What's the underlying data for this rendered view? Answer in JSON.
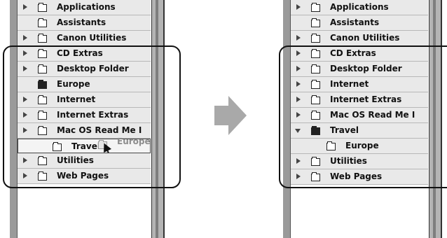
{
  "before": {
    "rows": [
      {
        "label": "Applications",
        "disclosure": "closed",
        "icon": "folder-icon"
      },
      {
        "label": "Assistants",
        "disclosure": "none",
        "icon": "folder-icon"
      },
      {
        "label": "Canon Utilities",
        "disclosure": "closed",
        "icon": "folder-icon"
      },
      {
        "label": "CD Extras",
        "disclosure": "closed",
        "icon": "folder-icon"
      },
      {
        "label": "Desktop Folder",
        "disclosure": "closed",
        "icon": "folder-icon"
      },
      {
        "label": "Europe",
        "disclosure": "none",
        "icon": "folder-dark-icon"
      },
      {
        "label": "Internet",
        "disclosure": "closed",
        "icon": "folder-icon"
      },
      {
        "label": "Internet Extras",
        "disclosure": "closed",
        "icon": "folder-icon"
      },
      {
        "label": "Mac OS Read Me I",
        "disclosure": "closed",
        "icon": "folder-icon"
      },
      {
        "label": "Travel",
        "disclosure": "none",
        "icon": "folder-icon",
        "drop_target": true
      },
      {
        "label": "Utilities",
        "disclosure": "closed",
        "icon": "folder-icon"
      },
      {
        "label": "Web Pages",
        "disclosure": "closed",
        "icon": "folder-icon"
      }
    ],
    "drag_ghost_label": "Europe"
  },
  "after": {
    "rows": [
      {
        "label": "Applications",
        "disclosure": "closed",
        "icon": "folder-icon"
      },
      {
        "label": "Assistants",
        "disclosure": "none",
        "icon": "folder-icon"
      },
      {
        "label": "Canon Utilities",
        "disclosure": "closed",
        "icon": "folder-icon"
      },
      {
        "label": "CD Extras",
        "disclosure": "closed",
        "icon": "folder-icon"
      },
      {
        "label": "Desktop Folder",
        "disclosure": "closed",
        "icon": "folder-icon"
      },
      {
        "label": "Internet",
        "disclosure": "closed",
        "icon": "folder-icon"
      },
      {
        "label": "Internet Extras",
        "disclosure": "closed",
        "icon": "folder-icon"
      },
      {
        "label": "Mac OS Read Me I",
        "disclosure": "closed",
        "icon": "folder-icon"
      },
      {
        "label": "Travel",
        "disclosure": "open",
        "icon": "folder-dark-icon"
      },
      {
        "label": "Europe",
        "disclosure": "none",
        "icon": "folder-icon",
        "nested": true
      },
      {
        "label": "Utilities",
        "disclosure": "closed",
        "icon": "folder-icon"
      },
      {
        "label": "Web Pages",
        "disclosure": "closed",
        "icon": "folder-icon"
      }
    ]
  }
}
